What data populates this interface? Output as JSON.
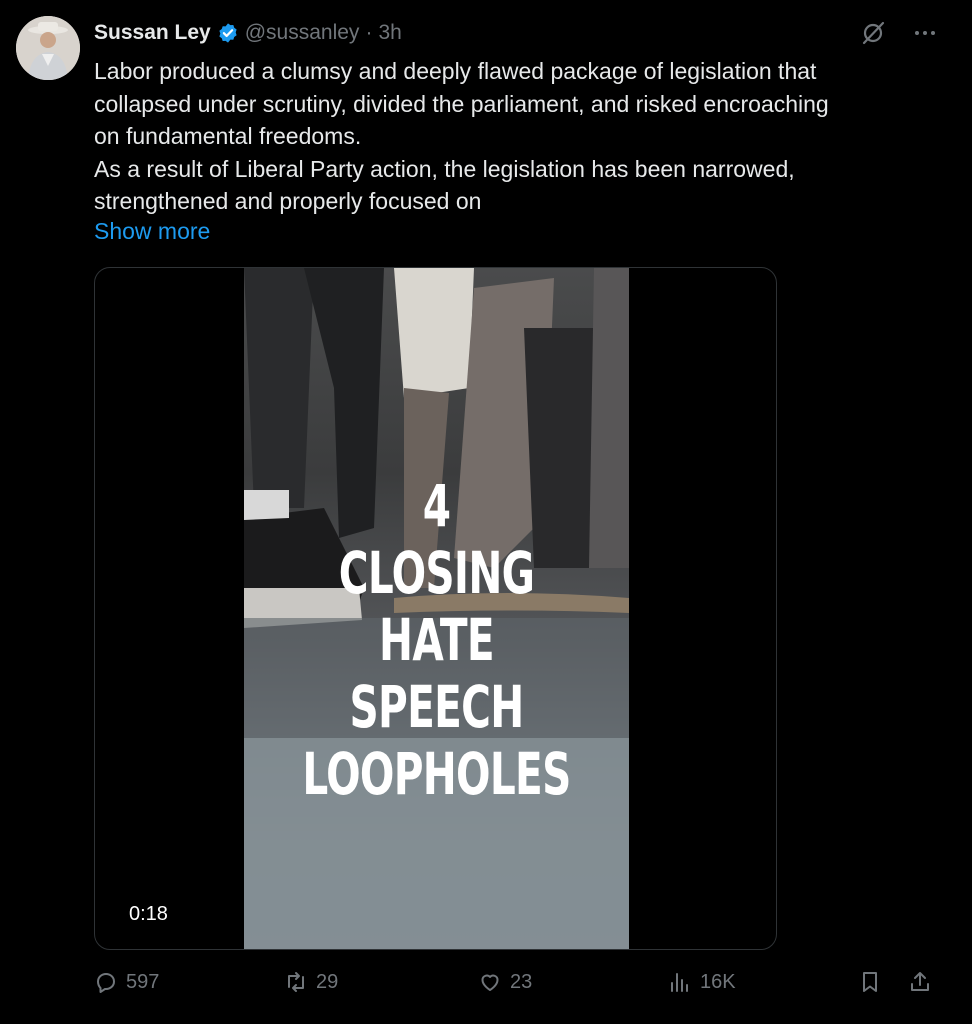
{
  "author": {
    "display_name": "Sussan Ley",
    "handle": "@sussanley",
    "separator": "·",
    "time": "3h",
    "avatar_icon": "profile-photo",
    "verified_icon": "verified-badge-icon"
  },
  "tweet": {
    "lines": [
      "Labor produced a clumsy and deeply flawed package of legislation that",
      "collapsed under scrutiny, divided the parliament, and risked encroaching",
      "on fundamental freedoms.",
      "As a result of Liberal Party action, the legislation has been narrowed,",
      "strengthened and properly focused on"
    ],
    "show_more": "Show more"
  },
  "video": {
    "caption_lines": [
      "4",
      "CLOSING HATE",
      "SPEECH",
      "LOOPHOLES"
    ],
    "duration": "0:18"
  },
  "actions": {
    "replies": "597",
    "reposts": "29",
    "likes": "23",
    "views": "16K"
  },
  "colors": {
    "background": "#000000",
    "text": "#e7e9ea",
    "secondary": "#71767b",
    "link": "#1d9bf0",
    "verified": "#1d9bf0"
  }
}
